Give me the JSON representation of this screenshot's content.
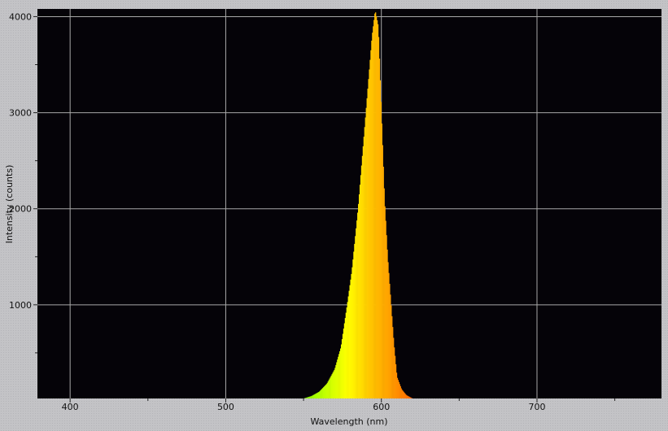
{
  "chart_data": {
    "type": "area",
    "title": "",
    "xlabel": "Wavelength (nm)",
    "ylabel": "Intensity (counts)",
    "xlim": [
      379,
      780
    ],
    "ylim": [
      25,
      4080
    ],
    "xticks": [
      400,
      500,
      600,
      700
    ],
    "yticks": [
      1000,
      2000,
      3000,
      4000
    ],
    "grid": true,
    "legend": "none",
    "plot_background": "#050308",
    "grid_color": "#a8a8a8",
    "fill": "wavelength-colored spectrum gradient (green to yellow to orange to red)",
    "x": [
      540,
      545,
      550,
      555,
      560,
      565,
      570,
      574,
      578,
      581,
      585,
      588,
      591,
      594,
      596,
      598,
      600,
      602,
      604,
      606,
      608,
      610,
      613,
      616,
      620,
      625,
      628
    ],
    "y": [
      5,
      12,
      25,
      50,
      95,
      180,
      330,
      560,
      1000,
      1350,
      2000,
      2600,
      3200,
      3800,
      4065,
      3900,
      3000,
      2100,
      1500,
      1050,
      600,
      250,
      120,
      60,
      25,
      8,
      2
    ]
  }
}
